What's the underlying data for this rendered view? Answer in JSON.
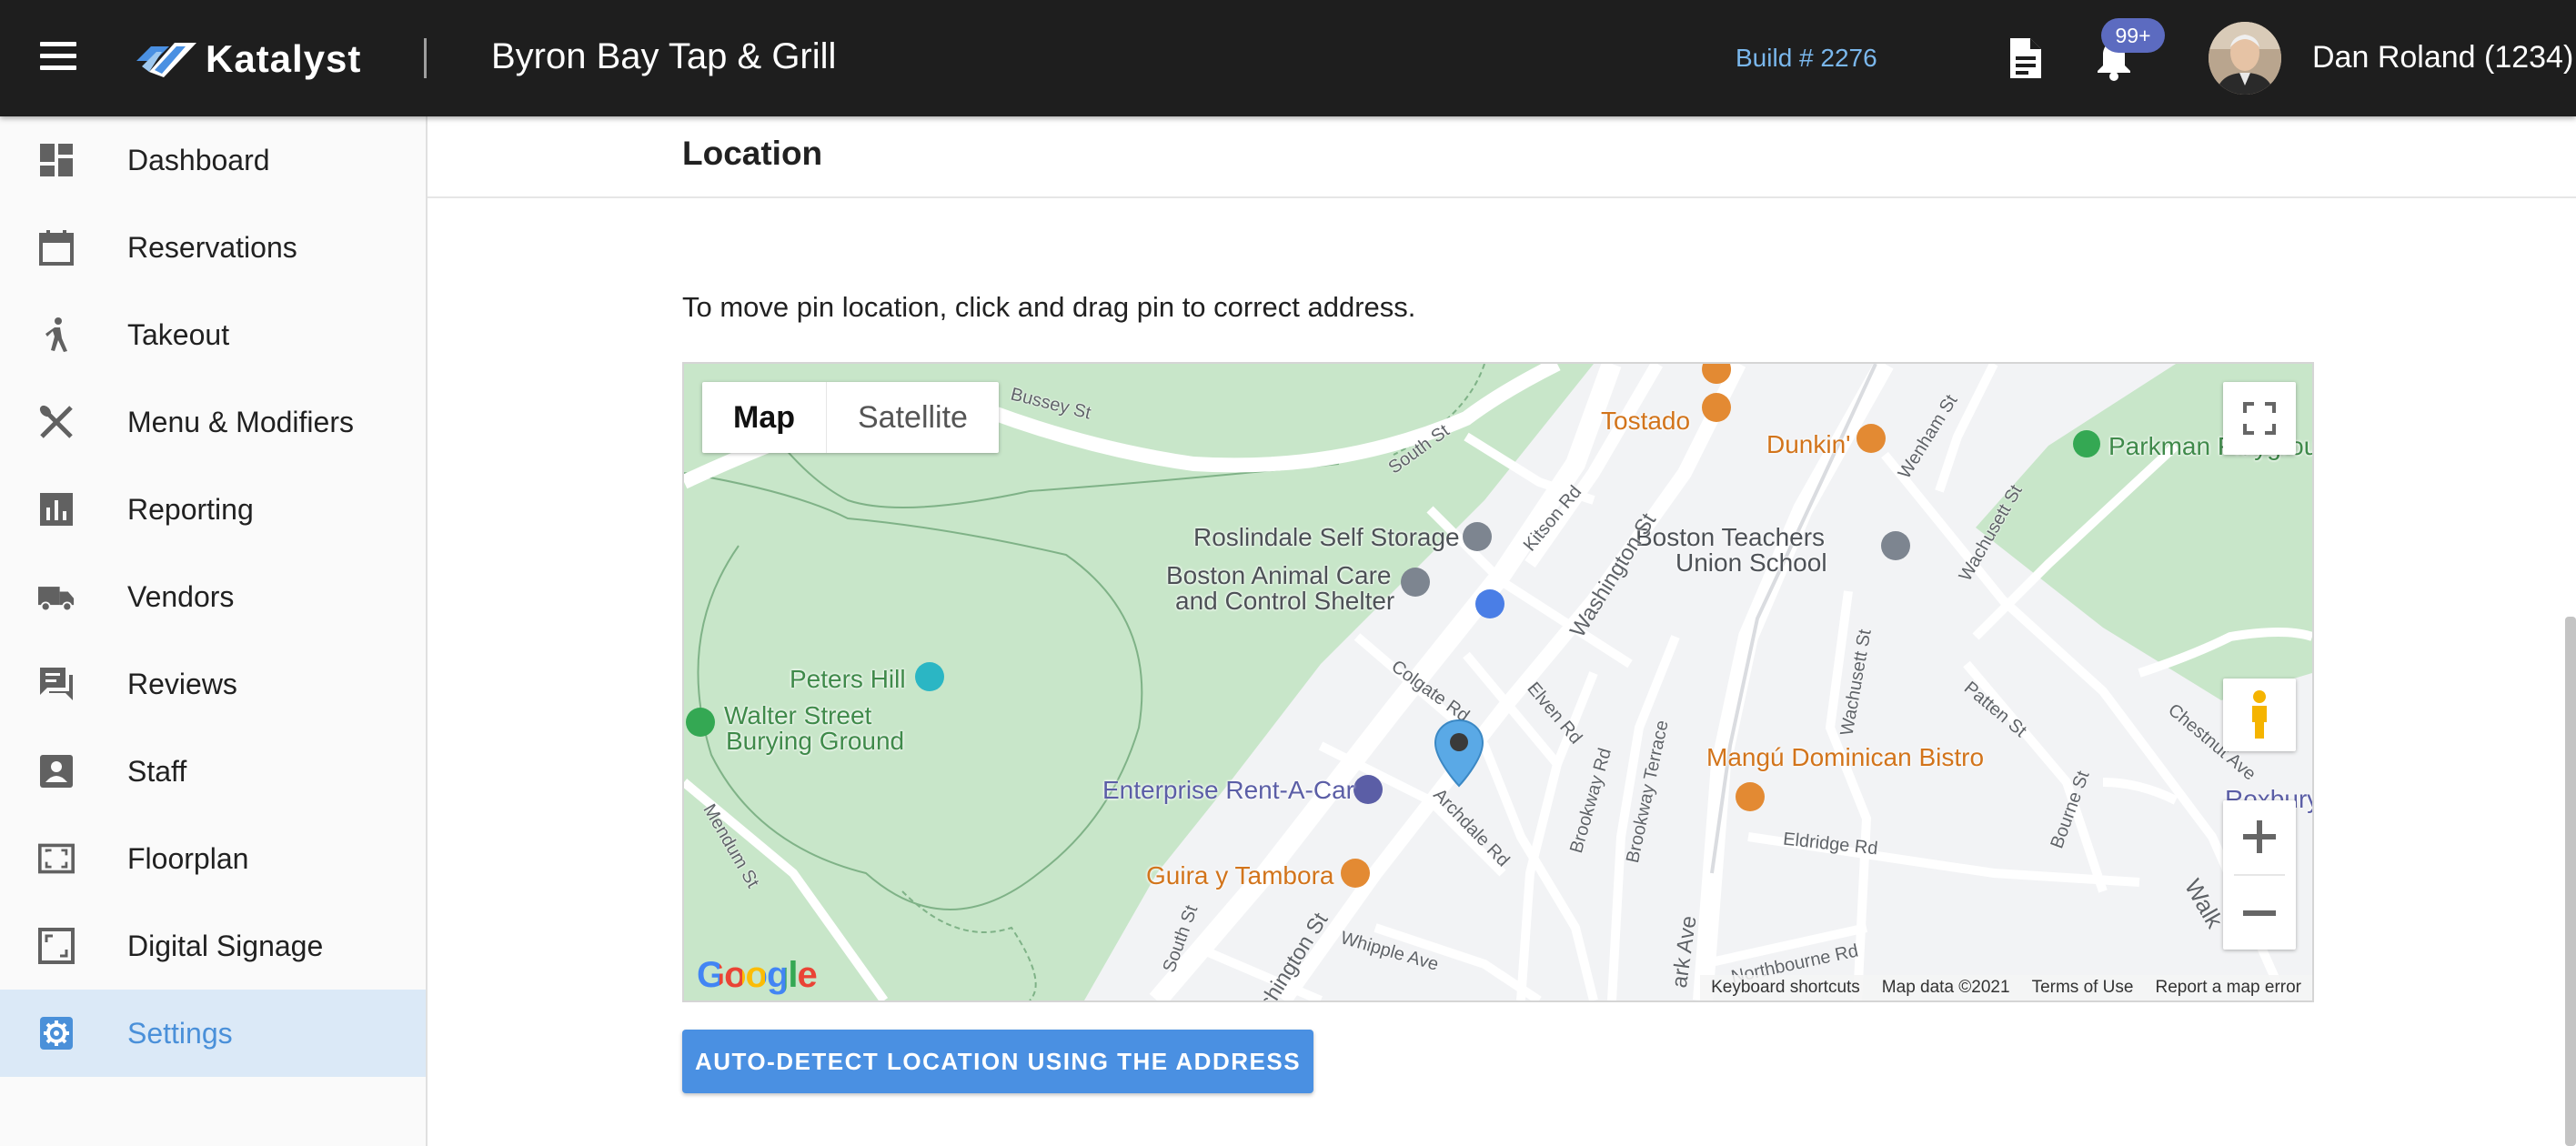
{
  "header": {
    "brand": "Katalyst",
    "restaurant": "Byron Bay Tap & Grill",
    "build": "Build # 2276",
    "notifications_badge": "99+",
    "user": "Dan Roland (1234)"
  },
  "sidebar": {
    "items": [
      {
        "label": "Dashboard",
        "icon": "dashboard-icon"
      },
      {
        "label": "Reservations",
        "icon": "calendar-icon"
      },
      {
        "label": "Takeout",
        "icon": "walking-person-icon"
      },
      {
        "label": "Menu & Modifiers",
        "icon": "utensils-icon"
      },
      {
        "label": "Reporting",
        "icon": "bar-chart-icon"
      },
      {
        "label": "Vendors",
        "icon": "truck-icon"
      },
      {
        "label": "Reviews",
        "icon": "chat-bubble-icon"
      },
      {
        "label": "Staff",
        "icon": "contact-card-icon"
      },
      {
        "label": "Floorplan",
        "icon": "floorplan-icon"
      },
      {
        "label": "Digital Signage",
        "icon": "picture-frame-icon"
      },
      {
        "label": "Settings",
        "icon": "gear-icon",
        "active": true
      }
    ]
  },
  "section": {
    "title": "Location",
    "instructions": "To move pin location, click and drag pin to correct address."
  },
  "map": {
    "type_options": [
      "Map",
      "Satellite"
    ],
    "selected_type": "Map",
    "places": {
      "tostado": "Tostado",
      "dunkin": "Dunkin'",
      "parkman": "Parkman Playgrou",
      "storage": "Roslindale Self Storage",
      "animal_care_1": "Boston Animal Care",
      "animal_care_2": "and Control Shelter",
      "teachers_1": "Boston Teachers",
      "teachers_2": "Union School",
      "peters_hill": "Peters Hill",
      "walter_1": "Walter Street",
      "walter_2": "Burying Ground",
      "enterprise": "Enterprise Rent-A-Car",
      "mangu": "Mangú Dominican Bistro",
      "guira": "Guira y Tambora",
      "roxbury": "Roxbury"
    },
    "streets": {
      "bussey": "Bussey St",
      "south_top": "South St",
      "kitson": "Kitson Rd",
      "washington": "Washington St",
      "wenham": "Wenham St",
      "wachusett": "Wachusett St",
      "wachusett_2": "Wachusett St",
      "colgate": "Colgate Rd",
      "elven": "Elven Rd",
      "brookway": "Brookway Rd",
      "brookway_terrace": "Brookway Terrace",
      "archdale": "Archdale Rd",
      "patten": "Patten St",
      "chestnut": "Chestnut Ave",
      "eldridge": "Eldridge Rd",
      "bourne": "Bourne St",
      "park_ave": "ark Ave",
      "south_bottom": "South St",
      "whipple": "Whipple Ave",
      "washington_bottom": "ashington St",
      "mendum": "Mendum St",
      "walk": "Walk",
      "northbourne": "Northbourne Rd"
    },
    "google_logo": "Google",
    "attribution": [
      "Keyboard shortcuts",
      "Map data ©2021",
      "Terms of Use",
      "Report a map error"
    ]
  },
  "actions": {
    "auto_detect": "AUTO-DETECT LOCATION USING THE ADDRESS"
  },
  "colors": {
    "topbar": "#1e1e1e",
    "accent": "#4a90e2",
    "active_nav_bg": "#dbe9f7",
    "park_green": "#c8e6c9",
    "badge": "#5c6bc0"
  }
}
